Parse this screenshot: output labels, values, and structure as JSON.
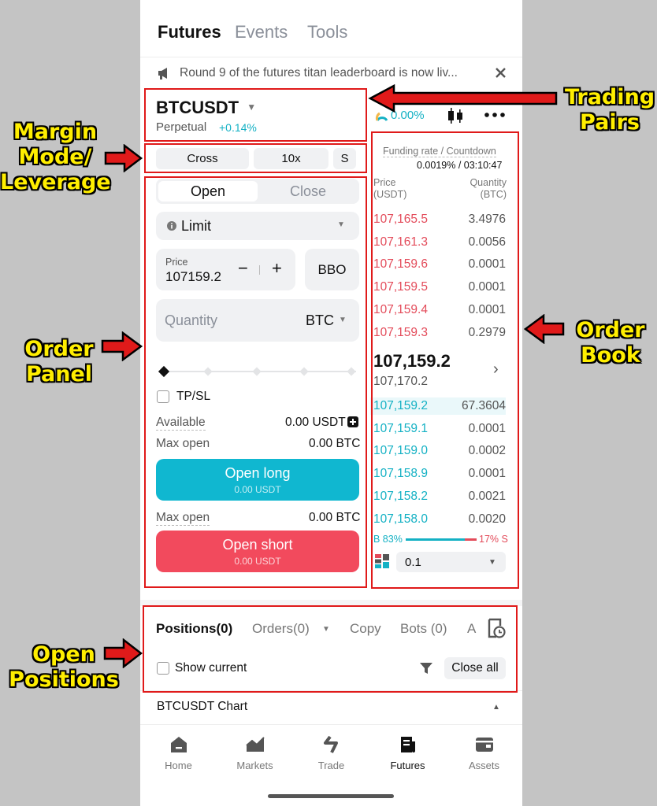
{
  "top_tabs": [
    "Futures",
    "Events",
    "Tools"
  ],
  "banner": {
    "text": "Round 9 of the futures titan leaderboard is now liv..."
  },
  "pair": {
    "symbol": "BTCUSDT",
    "type": "Perpetual",
    "change": "+0.14%",
    "ratio": "0.00%"
  },
  "margin": {
    "mode": "Cross",
    "leverage": "10x",
    "size": "S"
  },
  "order": {
    "tabs": [
      "Open",
      "Close"
    ],
    "type": "Limit",
    "price_label": "Price",
    "price_value": "107159.2",
    "minus": "−",
    "plus": "+",
    "bbo": "BBO",
    "quantity_placeholder": "Quantity",
    "quantity_unit": "BTC",
    "tpsl": "TP/SL",
    "available_label": "Available",
    "available_value": "0.00 USDT",
    "max_open_label": "Max open",
    "max_open_long": "0.00 BTC",
    "max_open_short": "0.00 BTC",
    "long_label": "Open long",
    "long_sub": "0.00 USDT",
    "short_label": "Open short",
    "short_sub": "0.00 USDT"
  },
  "orderbook": {
    "funding_label": "Funding rate / Countdown",
    "funding_value": "0.0019% / 03:10:47",
    "price_header": "Price\n(USDT)",
    "qty_header": "Quantity\n(BTC)",
    "asks": [
      {
        "price": "107,165.5",
        "qty": "3.4976"
      },
      {
        "price": "107,161.3",
        "qty": "0.0056"
      },
      {
        "price": "107,159.6",
        "qty": "0.0001"
      },
      {
        "price": "107,159.5",
        "qty": "0.0001"
      },
      {
        "price": "107,159.4",
        "qty": "0.0001"
      },
      {
        "price": "107,159.3",
        "qty": "0.2979"
      }
    ],
    "last_price": "107,159.2",
    "mark_price": "107,170.2",
    "bids": [
      {
        "price": "107,159.2",
        "qty": "67.3604"
      },
      {
        "price": "107,159.1",
        "qty": "0.0001"
      },
      {
        "price": "107,159.0",
        "qty": "0.0002"
      },
      {
        "price": "107,158.9",
        "qty": "0.0001"
      },
      {
        "price": "107,158.2",
        "qty": "0.0021"
      },
      {
        "price": "107,158.0",
        "qty": "0.0020"
      }
    ],
    "buy_ratio": "B 83%",
    "sell_ratio": "17% S",
    "buy_fraction": 0.83,
    "precision": "0.1"
  },
  "positions": {
    "tabs": [
      "Positions(0)",
      "Orders(0)",
      "Copy",
      "Bots (0)",
      "A"
    ],
    "show_current": "Show current",
    "close_all": "Close all"
  },
  "chart_row": {
    "label": "BTCUSDT Chart"
  },
  "nav": [
    "Home",
    "Markets",
    "Trade",
    "Futures",
    "Assets"
  ],
  "annotations": {
    "trading_pairs": "Trading\nPairs",
    "margin_mode": "Margin\nMode/\nLeverage",
    "order_panel": "Order\nPanel",
    "order_book": "Order\nBook",
    "open_positions": "Open\nPositions"
  },
  "colors": {
    "ask": "#e34b5a",
    "bid": "#14b1c4",
    "long": "#10b7d0",
    "short": "#f24a5d",
    "annotation": "#ffee00",
    "highlight": "#e01a1a"
  }
}
